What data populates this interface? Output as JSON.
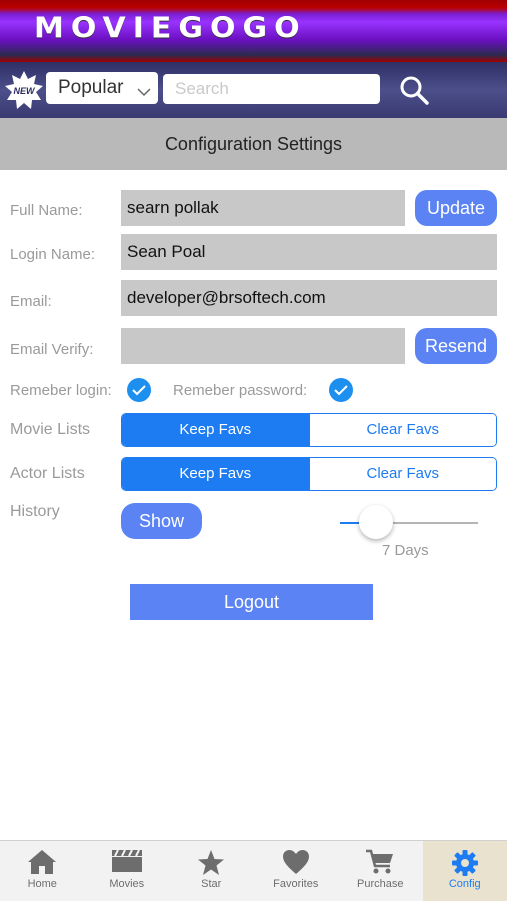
{
  "header": {
    "logo": "MOVIEGOGO",
    "new_badge": "NEW",
    "category_select": "Popular",
    "search_placeholder": "Search"
  },
  "page_title": "Configuration Settings",
  "form": {
    "full_name": {
      "label": "Full Name:",
      "value": "searn pollak",
      "button": "Update"
    },
    "login_name": {
      "label": "Login Name:",
      "value": "Sean Poal"
    },
    "email": {
      "label": "Email:",
      "value": "developer@brsoftech.com"
    },
    "email_verify": {
      "label": "Email Verify:",
      "value": "",
      "button": "Resend"
    },
    "remember_login": {
      "label": "Remeber login:",
      "checked": true
    },
    "remember_password": {
      "label": "Remeber password:",
      "checked": true
    },
    "movie_lists": {
      "label": "Movie Lists",
      "options": [
        "Keep Favs",
        "Clear Favs"
      ],
      "selected": "Keep Favs"
    },
    "actor_lists": {
      "label": "Actor Lists",
      "options": [
        "Keep Favs",
        "Clear Favs"
      ],
      "selected": "Keep Favs"
    },
    "history": {
      "label": "History",
      "button": "Show",
      "slider_value": "7 Days"
    },
    "logout": "Logout"
  },
  "tabs": [
    {
      "label": "Home",
      "icon": "home-icon"
    },
    {
      "label": "Movies",
      "icon": "clapperboard-icon"
    },
    {
      "label": "Star",
      "icon": "star-icon"
    },
    {
      "label": "Favorites",
      "icon": "heart-icon"
    },
    {
      "label": "Purchase",
      "icon": "cart-icon"
    },
    {
      "label": "Config",
      "icon": "gear-icon",
      "active": true
    }
  ],
  "colors": {
    "accent": "#5b83f3",
    "segment": "#1d7cf2",
    "check": "#1d8fef",
    "title_bar": "#b9b9b9",
    "field_bg": "#c8c8c8"
  }
}
